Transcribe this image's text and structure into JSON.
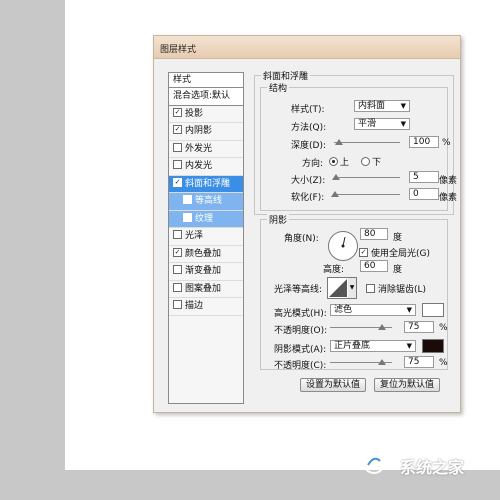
{
  "dialog": {
    "title": "图层样式"
  },
  "left_panel": {
    "header": "样式",
    "blend": "混合选项:默认",
    "items": [
      {
        "label": "投影",
        "checked": true
      },
      {
        "label": "内阴影",
        "checked": true
      },
      {
        "label": "外发光",
        "checked": false
      },
      {
        "label": "内发光",
        "checked": false
      },
      {
        "label": "斜面和浮雕",
        "checked": true,
        "selected": true
      },
      {
        "label": "等高线",
        "checked": false,
        "sub": true
      },
      {
        "label": "纹理",
        "checked": false,
        "sub": true
      },
      {
        "label": "光泽",
        "checked": false
      },
      {
        "label": "颜色叠加",
        "checked": true
      },
      {
        "label": "渐变叠加",
        "checked": false
      },
      {
        "label": "图案叠加",
        "checked": false
      },
      {
        "label": "描边",
        "checked": false
      }
    ]
  },
  "bevel": {
    "group_title": "斜面和浮雕",
    "structure_title": "结构",
    "style_label": "样式(T):",
    "style_value": "内斜面",
    "technique_label": "方法(Q):",
    "technique_value": "平滑",
    "depth_label": "深度(D):",
    "depth_value": "100",
    "depth_unit": "%",
    "direction_label": "方向:",
    "dir_up": "上",
    "dir_down": "下",
    "direction_selected": "上",
    "size_label": "大小(Z):",
    "size_value": "5",
    "size_unit": "像素",
    "soften_label": "软化(F):",
    "soften_value": "0",
    "soften_unit": "像素"
  },
  "shading": {
    "title": "阴影",
    "angle_label": "角度(N):",
    "angle_value": "80",
    "angle_unit": "度",
    "global_light_label": "使用全局光(G)",
    "global_light_checked": true,
    "altitude_label": "高度:",
    "altitude_value": "60",
    "altitude_unit": "度",
    "gloss_label": "光泽等高线:",
    "antialias_label": "消除锯齿(L)",
    "antialias_checked": false,
    "highlight_label": "高光模式(H):",
    "highlight_value": "滤色",
    "highlight_color": "#ffffff",
    "highlight_opacity_label": "不透明度(O):",
    "highlight_opacity_value": "75",
    "highlight_opacity_unit": "%",
    "shadow_label": "阴影模式(A):",
    "shadow_value": "正片叠底",
    "shadow_color": "#000000",
    "shadow_opacity_label": "不透明度(C):",
    "shadow_opacity_value": "75",
    "shadow_opacity_unit": "%"
  },
  "buttons": {
    "make_default": "设置为默认值",
    "reset_default": "复位为默认值"
  },
  "watermark": {
    "text": "系统之家"
  }
}
